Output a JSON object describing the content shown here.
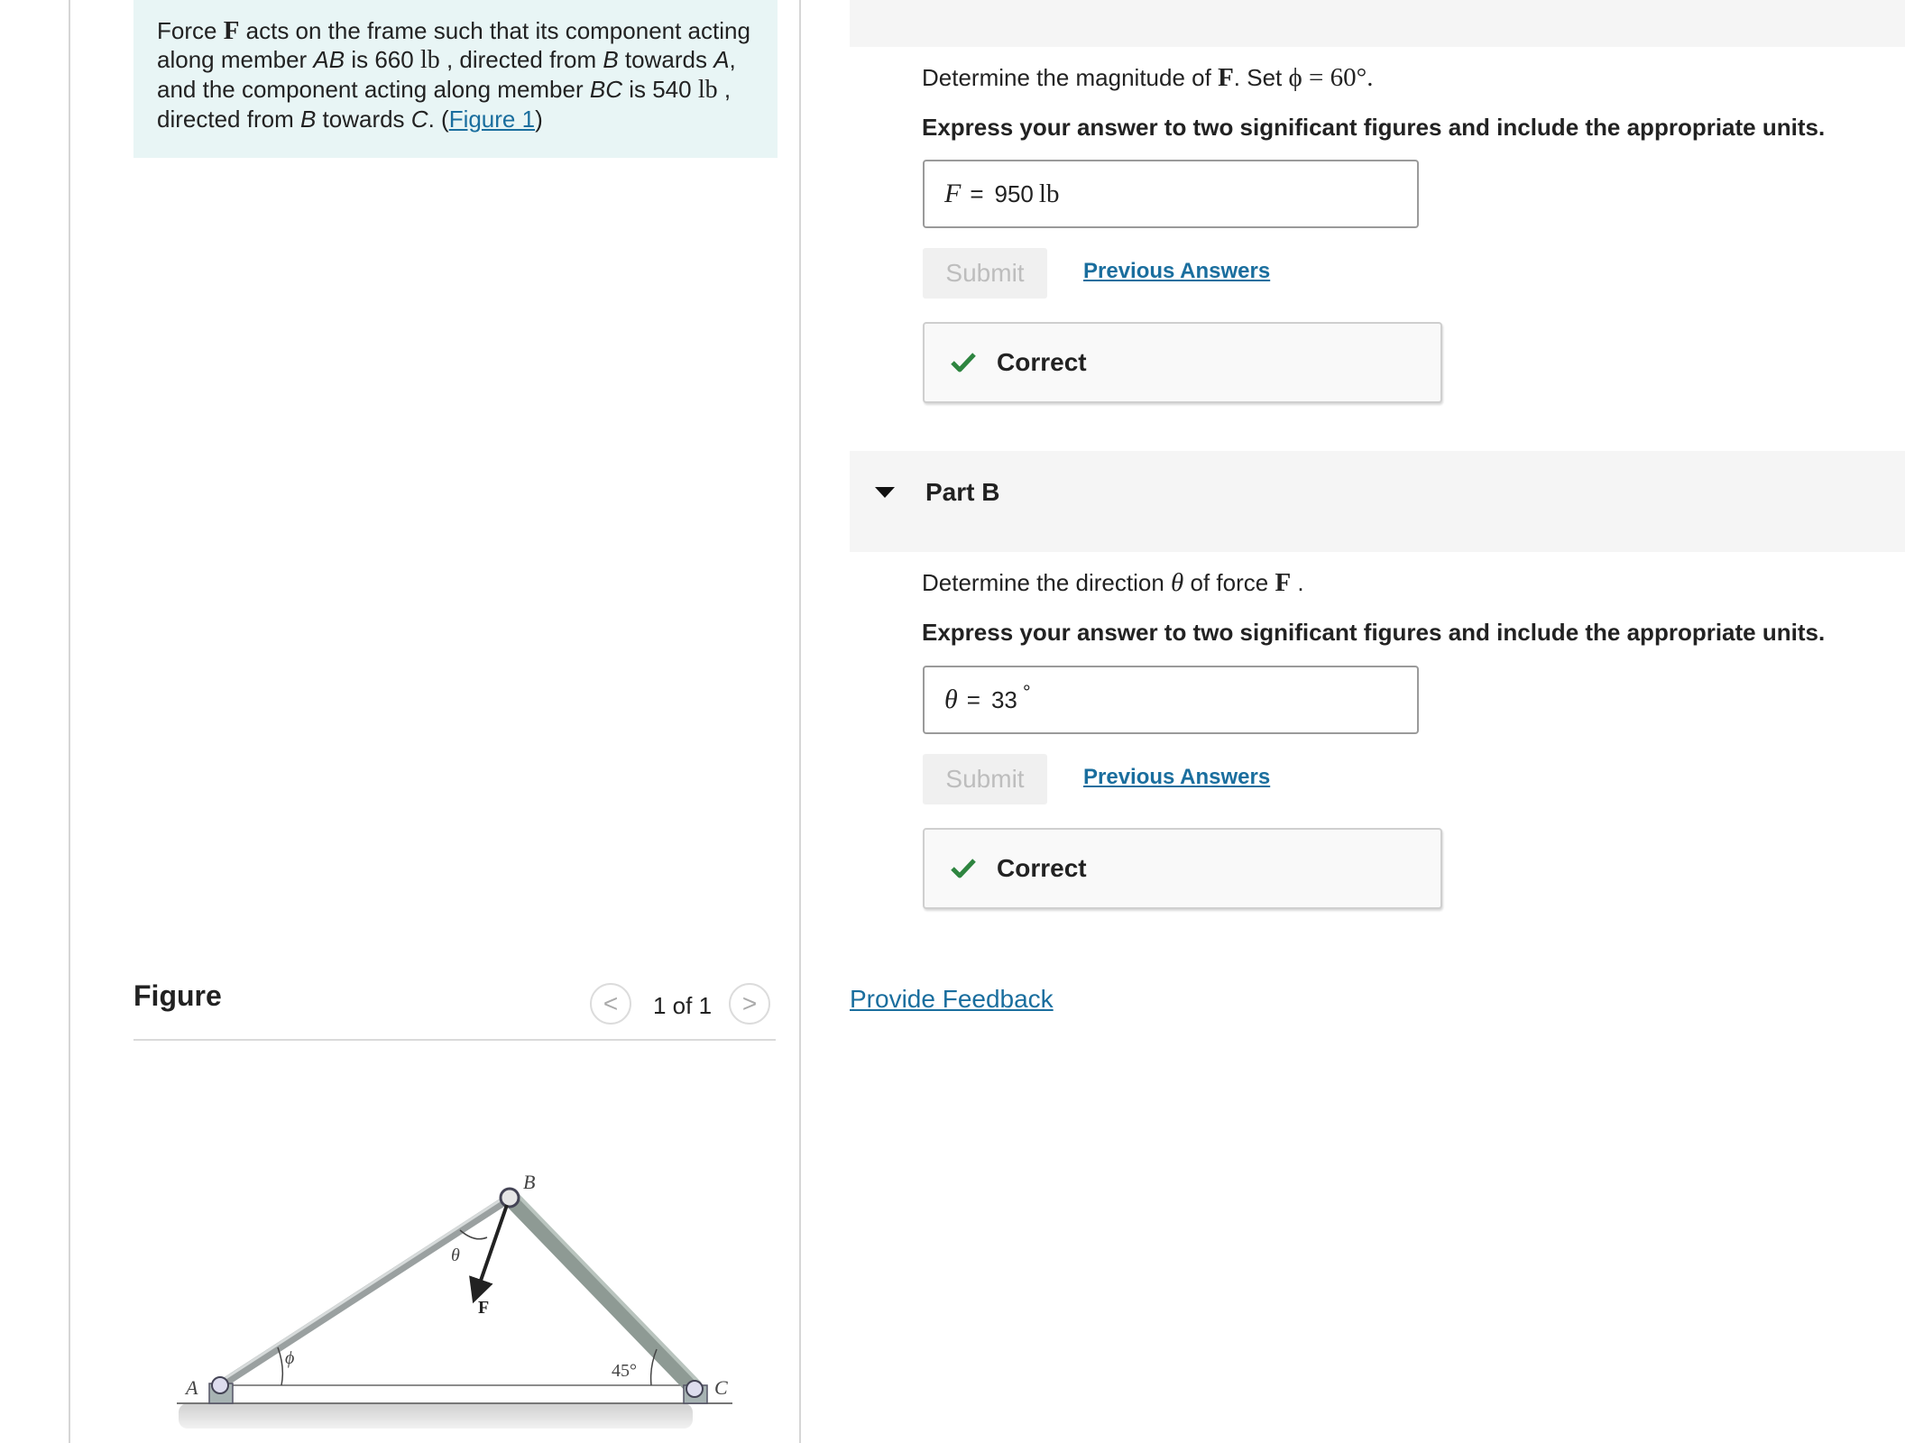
{
  "statement": {
    "p1": "Force ",
    "F": "F",
    "p2": " acts on the frame such that its component acting along member ",
    "AB": "AB",
    "p3": " is 660 ",
    "u1": "lb",
    "p4": " , directed from ",
    "B1": "B",
    "p5": " towards ",
    "A": "A",
    "p6": ", and the component acting along member ",
    "BC": "BC",
    "p7": " is 540 ",
    "u2": "lb",
    "p8": " , directed from ",
    "B2": "B",
    "p9": " towards ",
    "C": "C",
    "p10": ". (",
    "figure_link": "Figure 1",
    "p11": ")"
  },
  "figure": {
    "title": "Figure",
    "pager": "1 of 1",
    "prev_glyph": "<",
    "next_glyph": ">",
    "labels": {
      "A": "A",
      "B": "B",
      "C": "C",
      "F": "F",
      "theta": "θ",
      "phi": "ϕ",
      "angle45": "45°"
    }
  },
  "partA": {
    "prompt_pre": "Determine the magnitude of ",
    "prompt_F": "F",
    "prompt_mid": ". Set ",
    "prompt_math": "ϕ = 60°.",
    "instruction": "Express your answer to two significant figures and include the appropriate units.",
    "var": "F",
    "eq": "=",
    "value": "950",
    "unit": "lb",
    "submit": "Submit",
    "previous": "Previous Answers",
    "status": "Correct"
  },
  "partB": {
    "header": "Part B",
    "prompt_pre": "Determine the direction ",
    "prompt_theta": "θ",
    "prompt_mid": " of force ",
    "prompt_F": "F",
    "prompt_end": " .",
    "instruction": "Express your answer to two significant figures and include the appropriate units.",
    "var": "θ",
    "eq": "=",
    "value": "33",
    "unit": "°",
    "submit": "Submit",
    "previous": "Previous Answers",
    "status": "Correct"
  },
  "feedback": "Provide Feedback",
  "colors": {
    "link": "#1a6e9e",
    "statement_bg": "#e8f5f5",
    "check": "#2e8540"
  }
}
